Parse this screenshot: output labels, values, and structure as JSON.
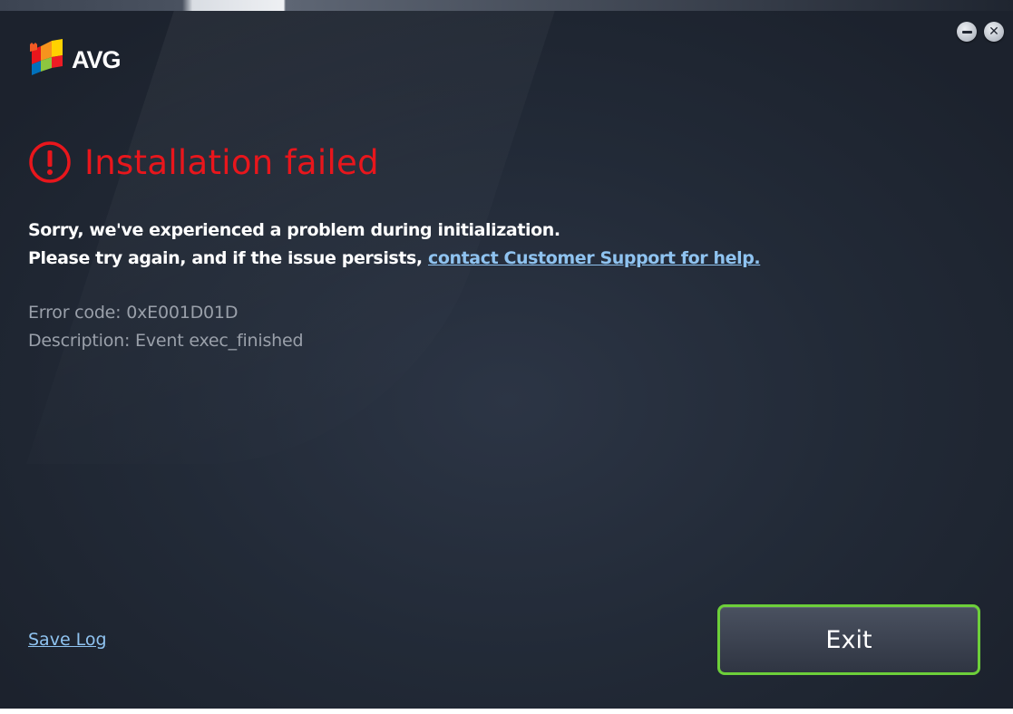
{
  "app": {
    "brand": "AVG",
    "accent_color": "#e8161c",
    "link_color": "#8fc3f0",
    "button_border_color": "#6dcf3a"
  },
  "title_controls": {
    "minimize_icon": "minimize-icon",
    "close_icon": "close-icon",
    "close_glyph": "✕"
  },
  "headline": {
    "icon": "error-circle-icon",
    "text": "Installation failed"
  },
  "message": {
    "line1": "Sorry, we've experienced a problem during initialization.",
    "line2_prefix": "Please try again, and if the issue persists, ",
    "support_link": "contact Customer Support for help."
  },
  "error": {
    "code_line": "Error code: 0xE001D01D",
    "description_line": "Description: Event exec_finished"
  },
  "footer": {
    "save_log": "Save Log",
    "exit_button": "Exit"
  }
}
